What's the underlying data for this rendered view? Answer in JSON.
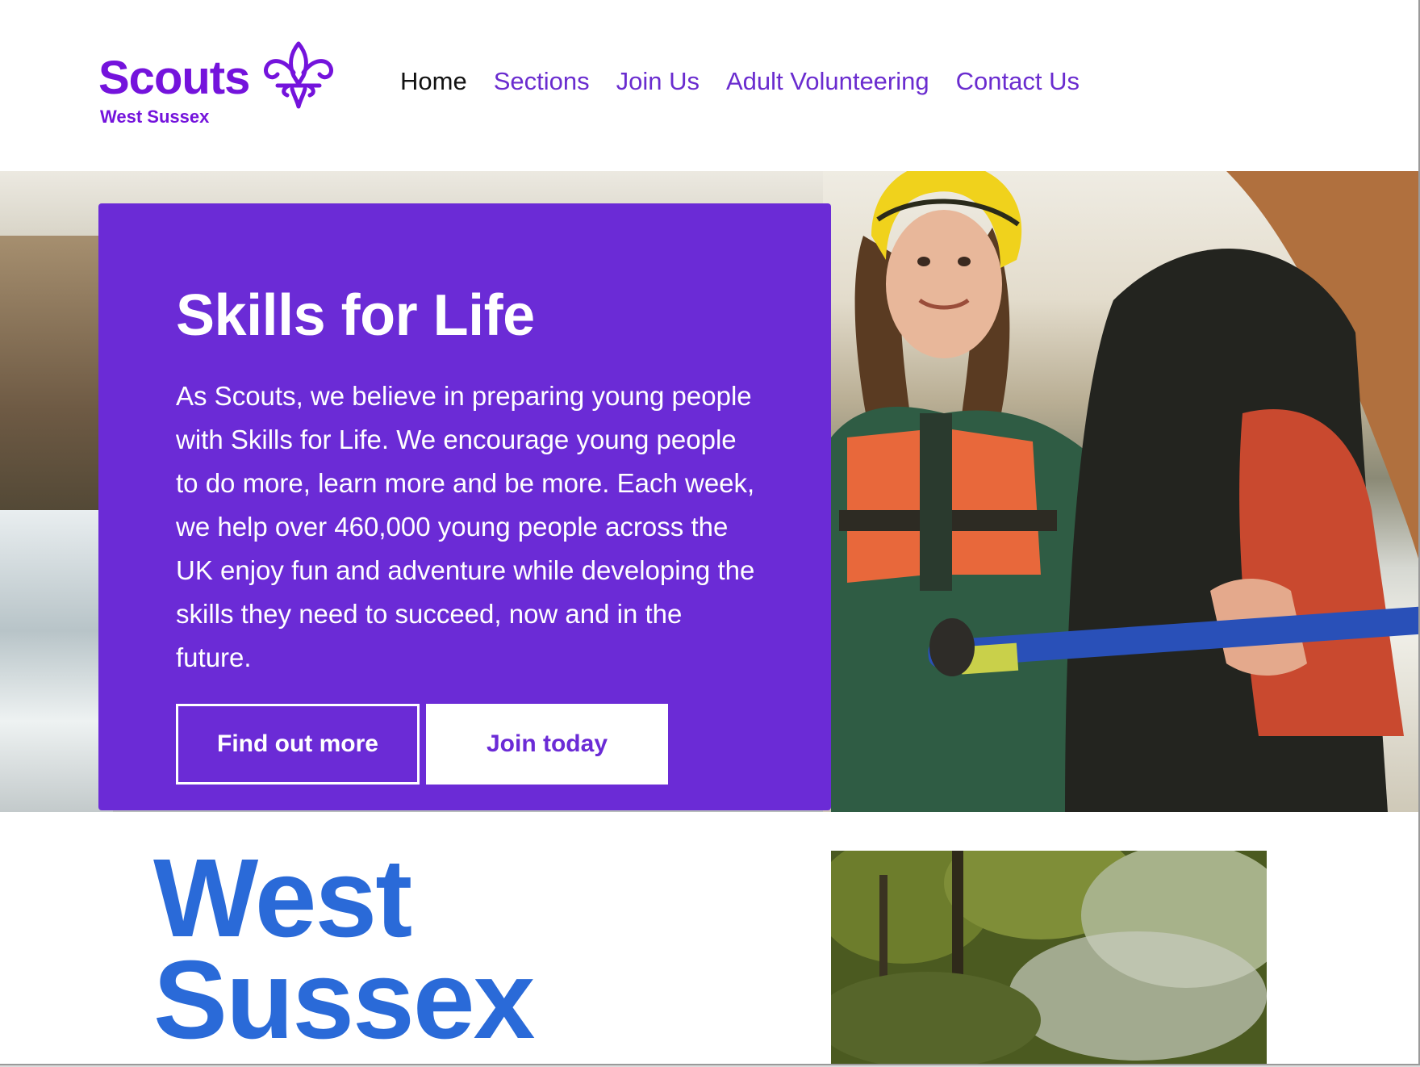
{
  "brand": {
    "name": "Scouts",
    "region": "West Sussex",
    "color": "#7413dc"
  },
  "nav": {
    "items": [
      {
        "label": "Home",
        "active": true
      },
      {
        "label": "Sections",
        "active": false
      },
      {
        "label": "Join Us",
        "active": false
      },
      {
        "label": "Adult Volunteering",
        "active": false
      },
      {
        "label": "Contact Us",
        "active": false
      }
    ]
  },
  "hero": {
    "title": "Skills for Life",
    "text": "As Scouts, we believe in preparing young people with Skills for Life. We encourage young people to do more, learn more and be more. Each week, we help over 460,000 young people across the UK enjoy fun and adventure while developing the skills they need to succeed, now and in the future.",
    "card_color": "#6b2bd6",
    "buttons": {
      "primary_label": "Find out more",
      "secondary_label": "Join today"
    }
  },
  "region_section": {
    "title_line1": "West",
    "title_line2": "Sussex",
    "title_color": "#2a6ad8"
  }
}
